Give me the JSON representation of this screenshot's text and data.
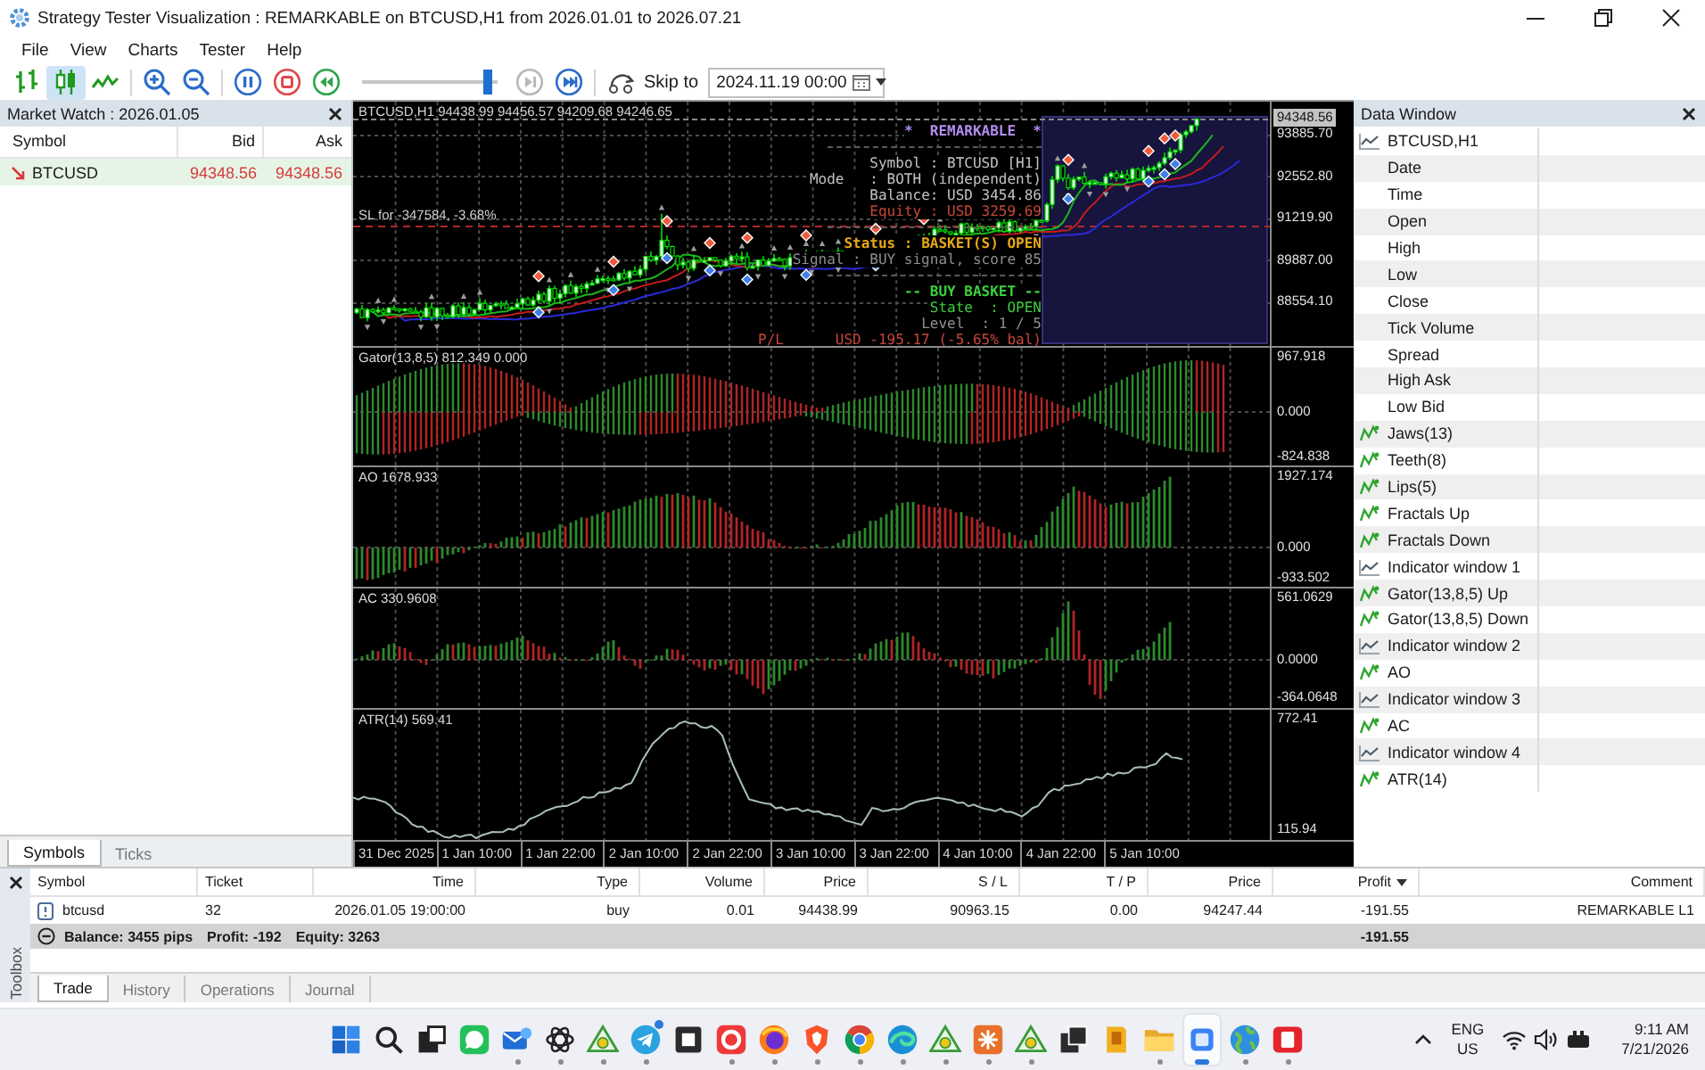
{
  "window": {
    "title": "Strategy Tester Visualization : REMARKABLE on BTCUSD,H1 from 2026.01.01 to 2026.07.21"
  },
  "menu": [
    "File",
    "View",
    "Charts",
    "Tester",
    "Help"
  ],
  "toolbar": {
    "chart_modes": [
      {
        "kind": "bars",
        "selected": false
      },
      {
        "kind": "candles",
        "selected": true
      },
      {
        "kind": "line",
        "selected": false
      }
    ],
    "zoom_buttons": [
      {
        "kind": "zoom-in"
      },
      {
        "kind": "zoom-out"
      }
    ],
    "playback_buttons": [
      {
        "kind": "pause"
      },
      {
        "kind": "stop"
      },
      {
        "kind": "rewind"
      }
    ],
    "speed_slider": {
      "level": 0.96
    },
    "step_buttons": [
      {
        "kind": "step",
        "disabled": true
      },
      {
        "kind": "skip-end",
        "disabled": false
      }
    ],
    "skip_to": {
      "label": "Skip to",
      "value": "2024.11.19 00:00"
    }
  },
  "market_watch": {
    "title": "Market Watch : 2026.01.05",
    "columns": [
      "Symbol",
      "Bid",
      "Ask"
    ],
    "rows": [
      {
        "symbol": "BTCUSD",
        "bid": "94348.56",
        "ask": "94348.56",
        "rising": false,
        "selected": true
      }
    ],
    "tabs": [
      {
        "label": "Symbols",
        "selected": true
      },
      {
        "label": "Ticks",
        "selected": false
      }
    ]
  },
  "chart": {
    "header": "BTCUSD,H1 94438.99 94456.57 94209.68 94246.65",
    "sl_label": "SL for -347584, -3.68%",
    "info_sections": [
      [
        {
          "kind": "title",
          "text": "*  REMARKABLE  *"
        }
      ],
      [
        {
          "kind": "info",
          "text": "Symbol : BTCUSD [H1]"
        },
        {
          "kind": "info",
          "text": "Mode   : BOTH (independent)"
        },
        {
          "kind": "info",
          "text": "Balance: USD 3454.86"
        },
        {
          "kind": "loss",
          "text": "Equity : USD 3259.69"
        }
      ],
      [
        {
          "kind": "status",
          "text": "Status : BASKET(S) OPEN"
        },
        {
          "kind": "muted",
          "text": "Signal : BUY signal, score 85"
        }
      ],
      [
        {
          "kind": "heading",
          "text": "-- BUY BASKET --"
        },
        {
          "kind": "good",
          "text": "State  : OPEN"
        },
        {
          "kind": "muted",
          "text": "Level  : 1 / 5"
        },
        {
          "kind": "loss",
          "text": "P/L      USD -195.17 (-5.65% bal)"
        }
      ]
    ],
    "price_axis": {
      "current": "94348.56",
      "ticks": [
        "93885.70",
        "92552.80",
        "91219.90",
        "89887.00",
        "88554.10"
      ]
    },
    "panes": [
      {
        "kind": "gator",
        "label": "Gator(13,8,5) 812.349 0.000",
        "axis": [
          "967.918",
          "0.000",
          "-824.838"
        ]
      },
      {
        "kind": "ao",
        "label": "AO 1678.933",
        "axis": [
          "1927.174",
          "0.000",
          "-933.502"
        ]
      },
      {
        "kind": "ac",
        "label": "AC 330.9608",
        "axis": [
          "561.0629",
          "0.0000",
          "-364.0648"
        ]
      },
      {
        "kind": "atr",
        "label": "ATR(14) 569.41",
        "axis": [
          "772.41",
          "115.94"
        ]
      }
    ],
    "time_axis": [
      "31 Dec 2025",
      "1 Jan 10:00",
      "1 Jan 22:00",
      "2 Jan 10:00",
      "2 Jan 22:00",
      "3 Jan 10:00",
      "3 Jan 22:00",
      "4 Jan 10:00",
      "4 Jan 22:00",
      "5 Jan 10:00"
    ]
  },
  "data_window": {
    "title": "Data Window",
    "rows": [
      {
        "kind": "chart",
        "label": "BTCUSD,H1"
      },
      {
        "kind": "field",
        "label": "Date"
      },
      {
        "kind": "field",
        "label": "Time"
      },
      {
        "kind": "field",
        "label": "Open"
      },
      {
        "kind": "field",
        "label": "High"
      },
      {
        "kind": "field",
        "label": "Low"
      },
      {
        "kind": "field",
        "label": "Close"
      },
      {
        "kind": "field",
        "label": "Tick Volume"
      },
      {
        "kind": "field",
        "label": "Spread"
      },
      {
        "kind": "field",
        "label": "High Ask"
      },
      {
        "kind": "field",
        "label": "Low Bid"
      },
      {
        "kind": "indicator",
        "label": "Jaws(13)"
      },
      {
        "kind": "indicator",
        "label": "Teeth(8)"
      },
      {
        "kind": "indicator",
        "label": "Lips(5)"
      },
      {
        "kind": "indicator",
        "label": "Fractals Up"
      },
      {
        "kind": "indicator",
        "label": "Fractals Down"
      },
      {
        "kind": "chart",
        "label": "Indicator window 1"
      },
      {
        "kind": "indicator",
        "label": "Gator(13,8,5) Up"
      },
      {
        "kind": "indicator",
        "label": "Gator(13,8,5) Down"
      },
      {
        "kind": "chart",
        "label": "Indicator window 2"
      },
      {
        "kind": "indicator",
        "label": "AO"
      },
      {
        "kind": "chart",
        "label": "Indicator window 3"
      },
      {
        "kind": "indicator",
        "label": "AC"
      },
      {
        "kind": "chart",
        "label": "Indicator window 4"
      },
      {
        "kind": "indicator",
        "label": "ATR(14)"
      }
    ]
  },
  "toolbox": {
    "title": "Toolbox",
    "columns": [
      {
        "label": "Symbol",
        "sorted": false
      },
      {
        "label": "Ticket",
        "sorted": false
      },
      {
        "label": "Time",
        "sorted": false
      },
      {
        "label": "Type",
        "sorted": false
      },
      {
        "label": "Volume",
        "sorted": false
      },
      {
        "label": "Price",
        "sorted": false
      },
      {
        "label": "S / L",
        "sorted": false
      },
      {
        "label": "T / P",
        "sorted": false
      },
      {
        "label": "Price",
        "sorted": false
      },
      {
        "label": "Profit",
        "sorted": true
      },
      {
        "label": "Comment",
        "sorted": false
      }
    ],
    "rows": [
      [
        "btcusd",
        "32",
        "2026.01.05 19:00:00",
        "buy",
        "0.01",
        "94438.99",
        "90963.15",
        "0.00",
        "94247.44",
        "-191.55",
        "REMARKABLE L1"
      ]
    ],
    "summary": {
      "expanded": true,
      "parts": [
        "Balance: 3455 pips",
        "Profit: -192",
        "Equity: 3263"
      ],
      "total": "-191.55"
    },
    "tabs": [
      {
        "label": "Trade",
        "selected": true
      },
      {
        "label": "History",
        "selected": false
      },
      {
        "label": "Operations",
        "selected": false
      },
      {
        "label": "Journal",
        "selected": false
      }
    ]
  },
  "taskbar": {
    "apps": [
      {
        "kind": "start",
        "running": false,
        "selected": false,
        "badge": false
      },
      {
        "kind": "search",
        "running": false,
        "selected": false,
        "badge": false
      },
      {
        "kind": "task-view",
        "running": false,
        "selected": false,
        "badge": false
      },
      {
        "kind": "chat",
        "running": false,
        "selected": false,
        "badge": false
      },
      {
        "kind": "mail",
        "running": true,
        "selected": false,
        "badge": false
      },
      {
        "kind": "knot",
        "running": true,
        "selected": false,
        "badge": false
      },
      {
        "kind": "triangle",
        "running": true,
        "selected": false,
        "badge": false
      },
      {
        "kind": "plane",
        "running": true,
        "selected": false,
        "badge": true
      },
      {
        "kind": "window",
        "running": false,
        "selected": false,
        "badge": false
      },
      {
        "kind": "ring-tile",
        "running": true,
        "selected": false,
        "badge": false
      },
      {
        "kind": "swirl",
        "running": true,
        "selected": false,
        "badge": false
      },
      {
        "kind": "shield",
        "running": true,
        "selected": false,
        "badge": false
      },
      {
        "kind": "segmented-circle",
        "running": true,
        "selected": false,
        "badge": false
      },
      {
        "kind": "wave",
        "running": true,
        "selected": false,
        "badge": false
      },
      {
        "kind": "triangle",
        "running": true,
        "selected": false,
        "badge": false
      },
      {
        "kind": "starburst",
        "running": true,
        "selected": false,
        "badge": false
      },
      {
        "kind": "triangle",
        "running": true,
        "selected": false,
        "badge": false
      },
      {
        "kind": "stack",
        "running": false,
        "selected": false,
        "badge": false
      },
      {
        "kind": "notebook",
        "running": false,
        "selected": false,
        "badge": false
      },
      {
        "kind": "folder",
        "running": true,
        "selected": false,
        "badge": false
      },
      {
        "kind": "square",
        "running": true,
        "selected": true,
        "badge": false
      },
      {
        "kind": "globe",
        "running": true,
        "selected": false,
        "badge": false
      },
      {
        "kind": "document-tile",
        "running": true,
        "selected": false,
        "badge": false
      }
    ],
    "tray": {
      "language": "ENG",
      "region": "US",
      "time": "9:11 AM",
      "date": "7/21/2026"
    }
  }
}
